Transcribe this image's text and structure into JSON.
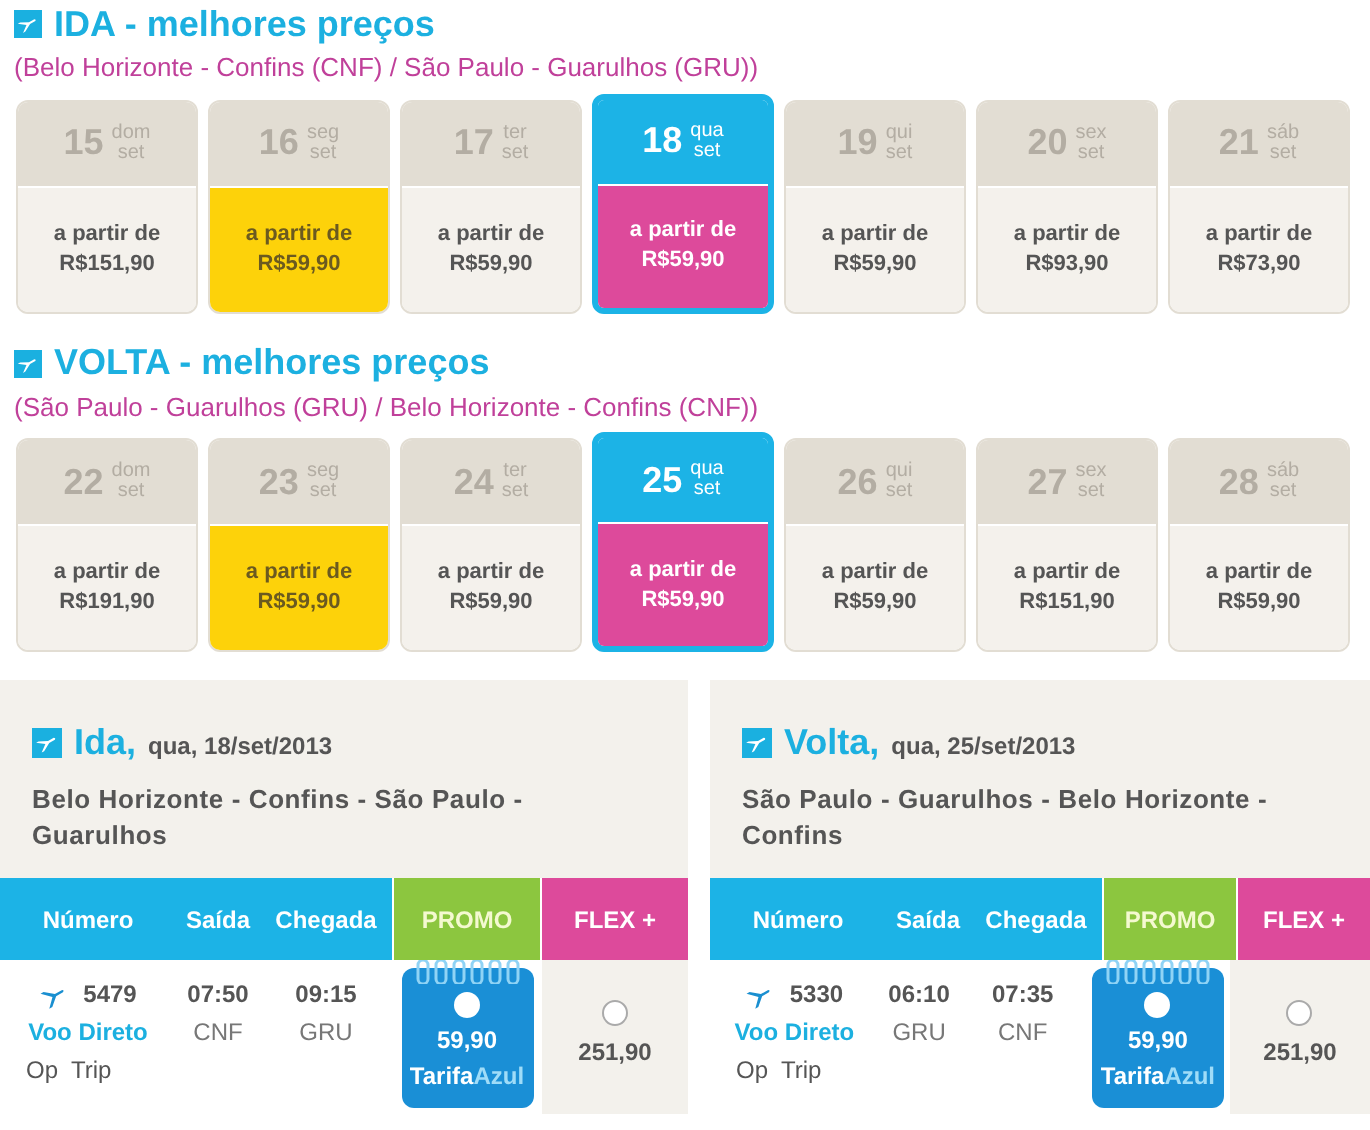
{
  "calendars": [
    {
      "title": "IDA",
      "title_rest": " - melhores preços",
      "route": "(Belo Horizonte - Confins (CNF) / São Paulo - Guarulhos (GRU))",
      "days": [
        {
          "day": "15",
          "weekday": "dom",
          "month": "set",
          "label": "a partir de",
          "price": "R$151,90",
          "selected": false,
          "cheapest": false
        },
        {
          "day": "16",
          "weekday": "seg",
          "month": "set",
          "label": "a partir de",
          "price": "R$59,90",
          "selected": false,
          "cheapest": true
        },
        {
          "day": "17",
          "weekday": "ter",
          "month": "set",
          "label": "a partir de",
          "price": "R$59,90",
          "selected": false,
          "cheapest": false
        },
        {
          "day": "18",
          "weekday": "qua",
          "month": "set",
          "label": "a partir de",
          "price": "R$59,90",
          "selected": true,
          "cheapest": false
        },
        {
          "day": "19",
          "weekday": "qui",
          "month": "set",
          "label": "a partir de",
          "price": "R$59,90",
          "selected": false,
          "cheapest": false
        },
        {
          "day": "20",
          "weekday": "sex",
          "month": "set",
          "label": "a partir de",
          "price": "R$93,90",
          "selected": false,
          "cheapest": false
        },
        {
          "day": "21",
          "weekday": "sáb",
          "month": "set",
          "label": "a partir de",
          "price": "R$73,90",
          "selected": false,
          "cheapest": false
        }
      ]
    },
    {
      "title": "VOLTA",
      "title_rest": " - melhores preços",
      "route": "(São Paulo - Guarulhos (GRU) / Belo Horizonte - Confins (CNF))",
      "days": [
        {
          "day": "22",
          "weekday": "dom",
          "month": "set",
          "label": "a partir de",
          "price": "R$191,90",
          "selected": false,
          "cheapest": false
        },
        {
          "day": "23",
          "weekday": "seg",
          "month": "set",
          "label": "a partir de",
          "price": "R$59,90",
          "selected": false,
          "cheapest": true
        },
        {
          "day": "24",
          "weekday": "ter",
          "month": "set",
          "label": "a partir de",
          "price": "R$59,90",
          "selected": false,
          "cheapest": false
        },
        {
          "day": "25",
          "weekday": "qua",
          "month": "set",
          "label": "a partir de",
          "price": "R$59,90",
          "selected": true,
          "cheapest": false
        },
        {
          "day": "26",
          "weekday": "qui",
          "month": "set",
          "label": "a partir de",
          "price": "R$59,90",
          "selected": false,
          "cheapest": false
        },
        {
          "day": "27",
          "weekday": "sex",
          "month": "set",
          "label": "a partir de",
          "price": "R$151,90",
          "selected": false,
          "cheapest": false
        },
        {
          "day": "28",
          "weekday": "sáb",
          "month": "set",
          "label": "a partir de",
          "price": "R$59,90",
          "selected": false,
          "cheapest": false
        }
      ]
    }
  ],
  "flights": [
    {
      "title": "Ida,",
      "date": "qua, 18/set/2013",
      "route": "Belo Horizonte - Confins - São Paulo - Guarulhos",
      "columns": [
        "Número",
        "Saída",
        "Chegada",
        "PROMO",
        "FLEX +"
      ],
      "row": {
        "number": "5479",
        "type": "Voo Direto",
        "operator": "Op  Trip",
        "departure": "07:50",
        "arrival": "09:15",
        "from": "CNF",
        "to": "GRU",
        "promo_price": "59,90",
        "promo_brand_a": "Tarifa",
        "promo_brand_b": "Azul",
        "promo_selected": false,
        "flex_price": "251,90",
        "flex_selected": false
      }
    },
    {
      "title": "Volta,",
      "date": "qua, 25/set/2013",
      "route": "São Paulo - Guarulhos - Belo Horizonte - Confins",
      "columns": [
        "Número",
        "Saída",
        "Chegada",
        "PROMO",
        "FLEX +"
      ],
      "row": {
        "number": "5330",
        "type": "Voo Direto",
        "operator": "Op  Trip",
        "departure": "06:10",
        "arrival": "07:35",
        "from": "GRU",
        "to": "CNF",
        "promo_price": "59,90",
        "promo_brand_a": "Tarifa",
        "promo_brand_b": "Azul",
        "promo_selected": false,
        "flex_price": "251,90",
        "flex_selected": false
      }
    }
  ]
}
